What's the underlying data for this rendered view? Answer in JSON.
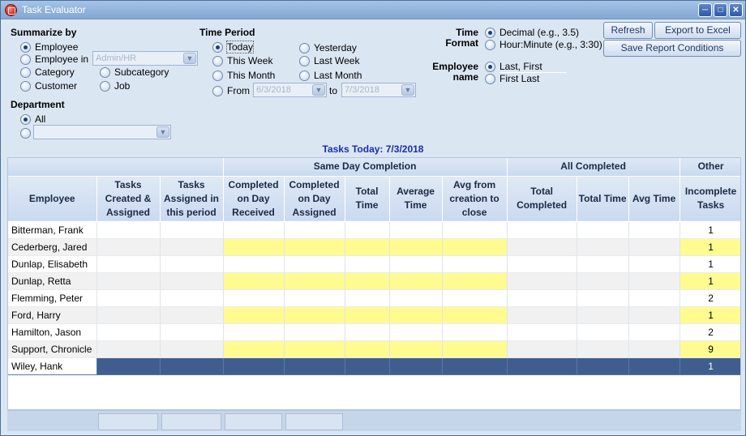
{
  "window": {
    "title": "Task Evaluator"
  },
  "summarize": {
    "label": "Summarize by",
    "options": {
      "employee": "Employee",
      "employee_in": "Employee in",
      "employee_in_value": "Admin/HR",
      "category": "Category",
      "subcategory": "Subcategory",
      "customer": "Customer",
      "job": "Job"
    },
    "selected": "employee"
  },
  "department": {
    "label": "Department",
    "all": "All",
    "selected": "all"
  },
  "time_period": {
    "label": "Time Period",
    "options": {
      "today": "Today",
      "yesterday": "Yesterday",
      "this_week": "This Week",
      "last_week": "Last Week",
      "this_month": "This Month",
      "last_month": "Last Month",
      "from": "From",
      "to": "to"
    },
    "from_value": "6/3/2018",
    "to_value": "7/3/2018",
    "selected": "today"
  },
  "time_format": {
    "label_line1": "Time",
    "label_line2": "Format",
    "decimal": "Decimal (e.g., 3.5)",
    "hour_minute": "Hour:Minute (e.g., 3:30)",
    "selected": "decimal"
  },
  "employee_name": {
    "label_line1": "Employee",
    "label_line2": "name",
    "last_first": "Last, First",
    "first_last": "First Last",
    "selected": "last_first"
  },
  "buttons": {
    "refresh": "Refresh",
    "export": "Export to Excel",
    "save": "Save Report Conditions"
  },
  "tasks_title": "Tasks Today: 7/3/2018",
  "table": {
    "groups": {
      "same_day": "Same Day Completion",
      "all_completed": "All Completed",
      "other": "Other"
    },
    "columns": {
      "employee": "Employee",
      "tasks_created": "Tasks Created & Assigned",
      "tasks_assigned": "Tasks Assigned in this period",
      "completed_received": "Completed on Day Received",
      "completed_assigned": "Completed on Day Assigned",
      "total_time": "Total Time",
      "average_time": "Average Time",
      "avg_creation": "Avg from creation to close",
      "total_completed": "Total Completed",
      "all_total_time": "Total Time",
      "avg_time": "Avg Time",
      "incomplete": "Incomplete Tasks"
    },
    "rows": [
      {
        "name": "Bitterman, Frank",
        "incomplete": "1"
      },
      {
        "name": "Cederberg, Jared",
        "incomplete": "1"
      },
      {
        "name": "Dunlap, Elisabeth",
        "incomplete": "1"
      },
      {
        "name": "Dunlap, Retta",
        "incomplete": "1"
      },
      {
        "name": "Flemming, Peter",
        "incomplete": "2"
      },
      {
        "name": "Ford, Harry",
        "incomplete": "1"
      },
      {
        "name": "Hamilton, Jason",
        "incomplete": "2"
      },
      {
        "name": "Support, Chronicle",
        "incomplete": "9"
      },
      {
        "name": "Wiley, Hank",
        "incomplete": "1"
      }
    ],
    "selected_row": 8
  },
  "colors": {
    "highlight": "#fffb90",
    "selected": "#3f5e8e",
    "title_text": "#1b2ea8"
  }
}
